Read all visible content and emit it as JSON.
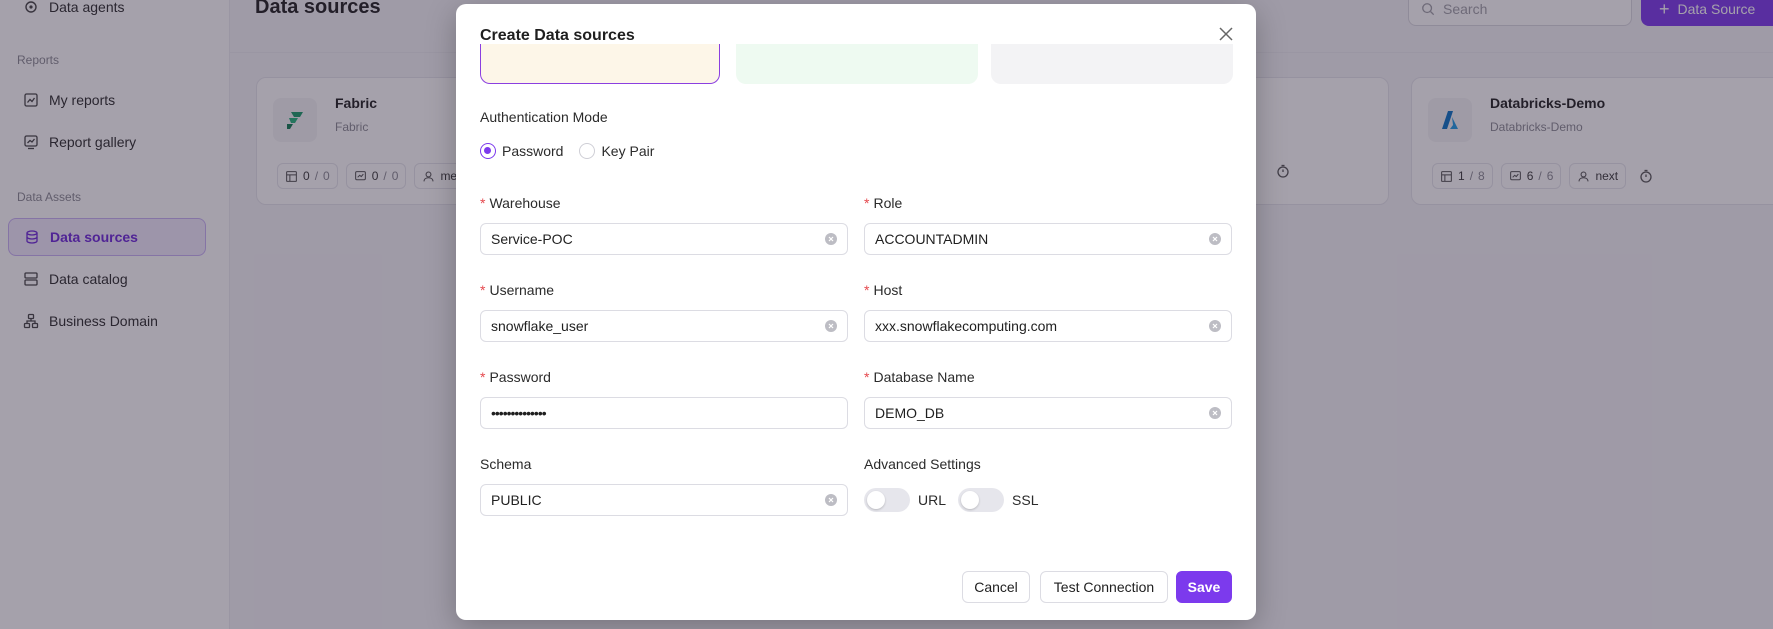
{
  "sidebar": {
    "items_top": [
      {
        "label": "Data agents",
        "icon": "agent-icon"
      }
    ],
    "sections": [
      "Reports",
      "Data Assets"
    ],
    "reports": [
      {
        "label": "My reports",
        "icon": "report-icon"
      },
      {
        "label": "Report gallery",
        "icon": "gallery-icon"
      }
    ],
    "assets": [
      {
        "label": "Data sources",
        "icon": "database-icon",
        "active": true
      },
      {
        "label": "Data catalog",
        "icon": "catalog-icon"
      },
      {
        "label": "Business Domain",
        "icon": "domain-icon"
      }
    ]
  },
  "header": {
    "title": "Data sources",
    "search_placeholder": "Search",
    "add_label": "Data Source"
  },
  "cards": [
    {
      "name": "Fabric",
      "sub": "Fabric",
      "stat1_a": "0",
      "stat1_b": "0",
      "stat2_a": "0",
      "stat2_b": "0",
      "user": "med"
    },
    {
      "name": "Databricks-Demo",
      "sub": "Databricks-Demo",
      "stat1_a": "1",
      "stat1_b": "8",
      "stat2_a": "6",
      "stat2_b": "6",
      "user": "next"
    }
  ],
  "modal": {
    "title": "Create Data sources",
    "auth_mode_label": "Authentication Mode",
    "auth_options": [
      "Password",
      "Key Pair"
    ],
    "auth_selected": "Password",
    "fields": {
      "warehouse": {
        "label": "Warehouse",
        "value": "Service-POC",
        "required": true
      },
      "role": {
        "label": "Role",
        "value": "ACCOUNTADMIN",
        "required": true
      },
      "username": {
        "label": "Username",
        "value": "snowflake_user",
        "required": true
      },
      "host": {
        "label": "Host",
        "value": "xxx.snowflakecomputing.com",
        "required": true
      },
      "password": {
        "label": "Password",
        "value": "••••••••••••••",
        "required": true
      },
      "database": {
        "label": "Database Name",
        "value": "DEMO_DB",
        "required": true
      },
      "schema": {
        "label": "Schema",
        "value": "PUBLIC",
        "required": false
      }
    },
    "advanced_label": "Advanced Settings",
    "toggles": [
      {
        "label": "URL",
        "on": false
      },
      {
        "label": "SSL",
        "on": false
      }
    ],
    "buttons": {
      "cancel": "Cancel",
      "test": "Test Connection",
      "save": "Save"
    }
  },
  "colors": {
    "accent": "#7c3aed",
    "required": "#e5484d"
  }
}
